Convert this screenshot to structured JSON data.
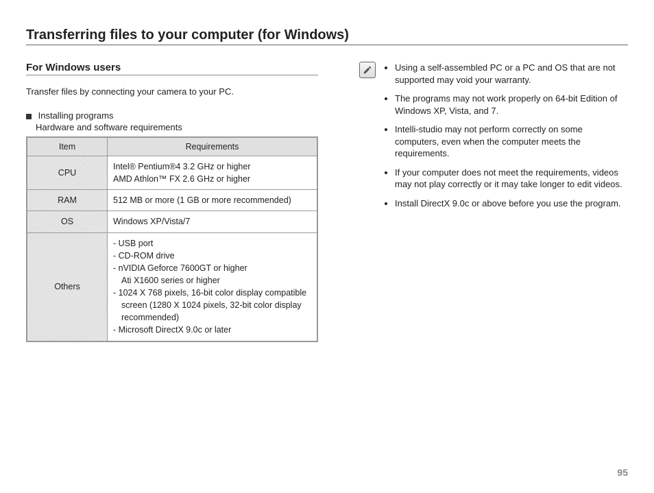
{
  "title": "Transferring files to your computer (for Windows)",
  "left": {
    "subheading": "For Windows users",
    "intro": "Transfer files by connecting your camera to your PC.",
    "section_label": "Installing programs",
    "section_sublabel": "Hardware and software requirements",
    "table": {
      "head_item": "Item",
      "head_req": "Requirements",
      "rows": [
        {
          "item": "CPU",
          "req_lines": [
            "Intel® Pentium®4 3.2 GHz or higher",
            "AMD Athlon™ FX 2.6 GHz or higher"
          ]
        },
        {
          "item": "RAM",
          "req_lines": [
            "512 MB or more (1 GB or more recommended)"
          ]
        },
        {
          "item": "OS",
          "req_lines": [
            "Windows XP/Vista/7"
          ]
        },
        {
          "item": "Others",
          "req_lines": [
            "- USB port",
            "- CD-ROM drive",
            "- nVIDIA Geforce 7600GT or higher",
            "  Ati X1600 series or higher",
            "- 1024 X 768 pixels, 16-bit color display compatible",
            "  screen (1280 X 1024 pixels, 32-bit color display",
            "  recommended)",
            "- Microsoft DirectX 9.0c or later"
          ]
        }
      ]
    }
  },
  "notes": [
    "Using a self-assembled PC or a PC and OS that are not supported may void your warranty.",
    "The programs may not work properly on 64-bit Edition of Windows XP, Vista, and 7.",
    "Intelli-studio may not perform correctly on some computers, even when the computer meets the requirements.",
    "If your computer does not meet the requirements, videos may not play correctly or it may take longer to edit videos.",
    "Install DirectX 9.0c or above before you use the program."
  ],
  "page_number": "95"
}
